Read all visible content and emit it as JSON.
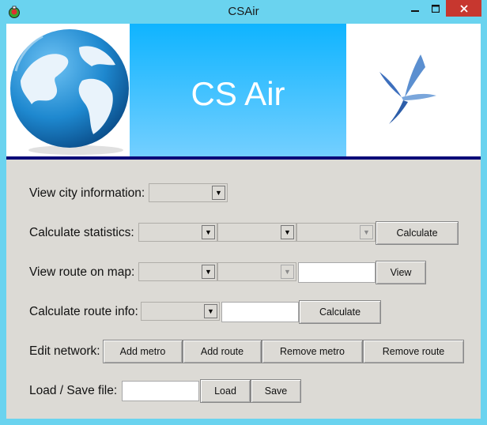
{
  "window": {
    "title": "CSAir"
  },
  "banner": {
    "title": "CS Air"
  },
  "rows": {
    "city_info": {
      "label": "View city information:"
    },
    "statistics": {
      "label": "Calculate statistics:",
      "button": "Calculate"
    },
    "route_map": {
      "label": "View route on map:",
      "button": "View"
    },
    "route_info": {
      "label": "Calculate route info:",
      "button": "Calculate"
    },
    "edit_network": {
      "label": "Edit network:",
      "add_metro": "Add metro",
      "add_route": "Add route",
      "remove_metro": "Remove metro",
      "remove_route": "Remove route"
    },
    "load_save": {
      "label": "Load / Save file:",
      "load": "Load",
      "save": "Save"
    }
  },
  "colors": {
    "titlebar": "#6ad3ef",
    "close": "#c7372f",
    "banner_band": "#0fb4ff",
    "accent_bar": "#0a0a78"
  },
  "icons": [
    "app-icon",
    "minimize-icon",
    "maximize-icon",
    "close-icon",
    "globe-image",
    "bird-logo"
  ]
}
